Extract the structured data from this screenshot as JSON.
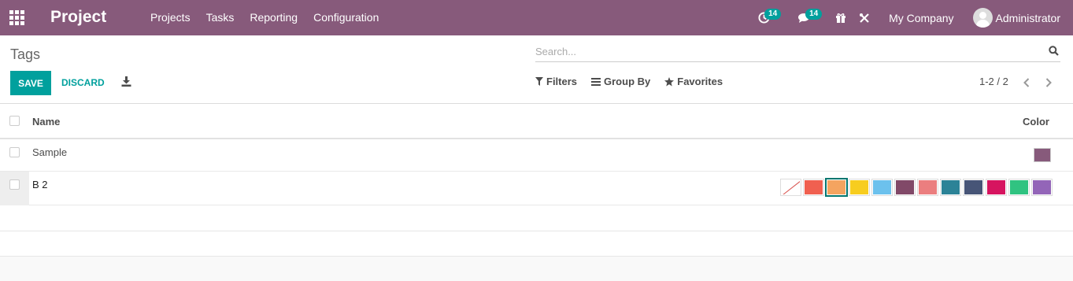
{
  "navbar": {
    "app_title": "Project",
    "menu": [
      "Projects",
      "Tasks",
      "Reporting",
      "Configuration"
    ],
    "activity_count": "14",
    "messages_count": "14",
    "company": "My Company",
    "user": "Administrator",
    "bg_color": "#875a7b"
  },
  "control_panel": {
    "breadcrumb": "Tags",
    "search_placeholder": "Search...",
    "save_label": "SAVE",
    "discard_label": "DISCARD",
    "filters_label": "Filters",
    "groupby_label": "Group By",
    "favorites_label": "Favorites",
    "pager": "1-2 / 2"
  },
  "table": {
    "columns": [
      "Name",
      "Color"
    ],
    "rows": [
      {
        "name": "Sample",
        "color": "#875a7b"
      },
      {
        "name": "B 2",
        "color_selected": "#f4a460"
      }
    ],
    "palette": [
      "none",
      "#f06050",
      "#f4a460",
      "#f7cd1f",
      "#6cc1ed",
      "#814968",
      "#eb7e7f",
      "#2c8397",
      "#475577",
      "#d6145f",
      "#30c381",
      "#9365b8"
    ],
    "palette_selected_index": 2
  }
}
